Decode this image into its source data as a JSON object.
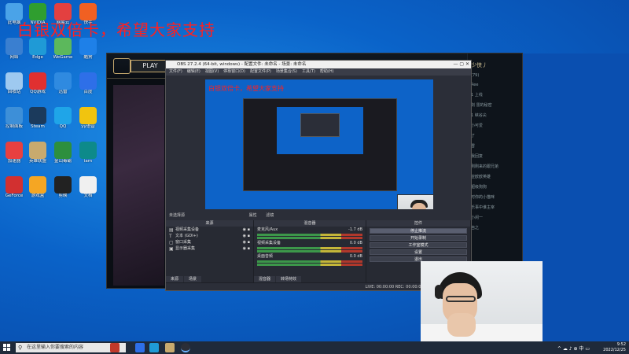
{
  "banner": "白银双倍卡，希望大家支持",
  "desktop_icons": [
    {
      "label": "此电脑",
      "color": "#4aa3e8"
    },
    {
      "label": "网络",
      "color": "#3a7fd0"
    },
    {
      "label": "回收站",
      "color": "#9ec9f0"
    },
    {
      "label": "控制面板",
      "color": "#3d8fd8"
    },
    {
      "label": "加速器",
      "color": "#e84040"
    },
    {
      "label": "GeForce",
      "color": "#d23030"
    },
    {
      "label": "NVIDIA",
      "color": "#2f9e2f"
    },
    {
      "label": "Edge",
      "color": "#1f9ad6"
    },
    {
      "label": "QQ游戏",
      "color": "#e03030"
    },
    {
      "label": "Steam",
      "color": "#1b3a5c"
    },
    {
      "label": "英雄联盟",
      "color": "#c8aa6e"
    },
    {
      "label": "游戏盒",
      "color": "#f5a623"
    },
    {
      "label": "网易云",
      "color": "#e34040"
    },
    {
      "label": "WeGame",
      "color": "#5cb85c"
    },
    {
      "label": "迅雷",
      "color": "#2f8ae0"
    },
    {
      "label": "QQ",
      "color": "#1fa5e8"
    },
    {
      "label": "金山毒霸",
      "color": "#2d8f3d"
    },
    {
      "label": "剪映",
      "color": "#222"
    },
    {
      "label": "快手",
      "color": "#f16022"
    },
    {
      "label": "酷狗",
      "color": "#1e80e8"
    },
    {
      "label": "百度",
      "color": "#2e6fe8"
    },
    {
      "label": "yy语音",
      "color": "#f1c40f"
    },
    {
      "label": "iam",
      "color": "#0d8a8a"
    },
    {
      "label": "文档",
      "color": "#f0f0f0"
    }
  ],
  "lol": {
    "play_label": "PLAY",
    "user_name": "少侠丿",
    "friends": [
      "(79)",
      "Ree",
      "1 上线",
      "剑 雷的秘密",
      "1 峡谷尖",
      "小可爱",
      "了",
      "雪",
      "我回复",
      "刚刚来的跟兄弟",
      "亚欧欧英雄",
      "超级狗狗",
      "时你的小猫咪",
      "乐事中谁主宰",
      "小闲一",
      "自之"
    ]
  },
  "obs": {
    "window_title": "OBS 27.2.4 (64-bit, windows) - 配置文件: 未命名 - 场景: 未命名",
    "menu": [
      "文件(F)",
      "编辑(E)",
      "视图(V)",
      "停靠窗口(D)",
      "配置文件(P)",
      "场景集合(S)",
      "工具(T)",
      "帮助(H)"
    ],
    "preview_banner": "白银双倍卡，希望大家支持",
    "status_label": "未选择源",
    "props_label": "属性",
    "filters_label": "滤镜",
    "docks": {
      "sources_title": "来源",
      "sources": [
        {
          "icon": "▤",
          "label": "视频采集设备"
        },
        {
          "icon": "T",
          "label": "文本 (GDI+)"
        },
        {
          "icon": "▢",
          "label": "窗口采集"
        },
        {
          "icon": "▣",
          "label": "显示器采集"
        }
      ],
      "mixer_title": "混音器",
      "mixer": [
        {
          "label": "麦克风/Aux",
          "db": "-1.7 dB"
        },
        {
          "label": "视频采集设备",
          "db": "0.0 dB"
        },
        {
          "label": "桌面音频",
          "db": "0.0 dB"
        }
      ],
      "mixer_tabs": [
        "混音器",
        "转场特效"
      ],
      "controls_title": "控件",
      "controls": [
        "停止推流",
        "开始录制",
        "工作室模式",
        "设置",
        "退出"
      ],
      "source_tabs": [
        "来源",
        "场景"
      ]
    },
    "footer": "LIVE: 00:00:00    REC: 00:00:00    CPU: 0.3%, 60.00 fps"
  },
  "taskbar": {
    "search_placeholder": "在这里输入你要搜索的内容",
    "time": "9:52",
    "date": "2022/12/25",
    "tray_icons": "^ ☁ ♪ ⊕ 中 ▭"
  }
}
